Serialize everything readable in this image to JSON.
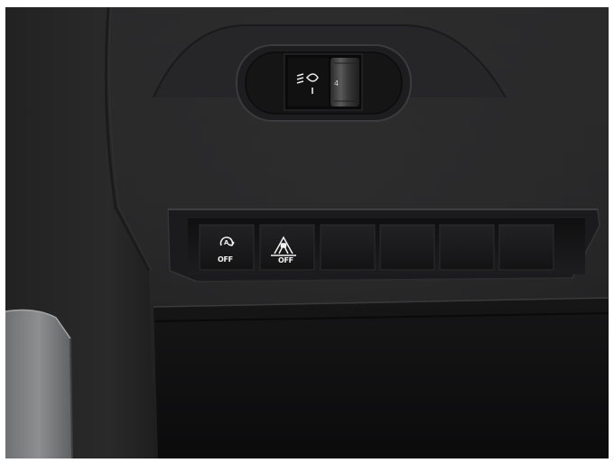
{
  "photo": {
    "headlamp_leveller": {
      "icon": "headlamp-level-icon",
      "wheel_setting": "4"
    },
    "switch_panel": {
      "buttons": [
        {
          "name": "stop-start-off-button",
          "icon": "auto-stop-start-icon",
          "label": "OFF"
        },
        {
          "name": "collision-alert-off-button",
          "icon": "collision-alert-icon",
          "label": "OFF"
        },
        {
          "name": "blank-switch-1",
          "icon": "",
          "label": ""
        },
        {
          "name": "blank-switch-2",
          "icon": "",
          "label": ""
        },
        {
          "name": "blank-switch-3",
          "icon": "",
          "label": ""
        },
        {
          "name": "blank-switch-4",
          "icon": "",
          "label": ""
        }
      ]
    },
    "colors": {
      "dashboard": "#1c1c1d",
      "trim": "#7d7f80",
      "symbol": "#f2f2f2"
    }
  }
}
